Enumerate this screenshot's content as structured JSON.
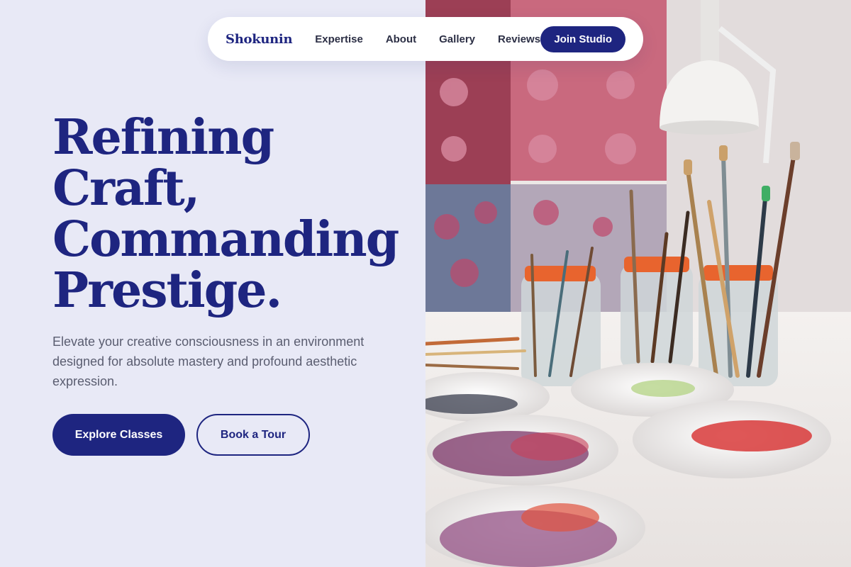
{
  "nav": {
    "brand": "Shokunin",
    "links": [
      "Expertise",
      "About",
      "Gallery",
      "Reviews"
    ],
    "cta": "Join Studio"
  },
  "hero": {
    "title_lines": [
      "Refining",
      "Craft,",
      "Commanding",
      "Prestige."
    ],
    "subtitle": "Elevate your creative consciousness in an environment designed for absolute mastery and profound aesthetic expression.",
    "primary_button": "Explore Classes",
    "secondary_button": "Book a Tour"
  },
  "image": {
    "description_icon": "art-studio-photo"
  },
  "colors": {
    "brand": "#1e2580",
    "background": "#e8e9f6",
    "text_muted": "#5a5d70"
  }
}
